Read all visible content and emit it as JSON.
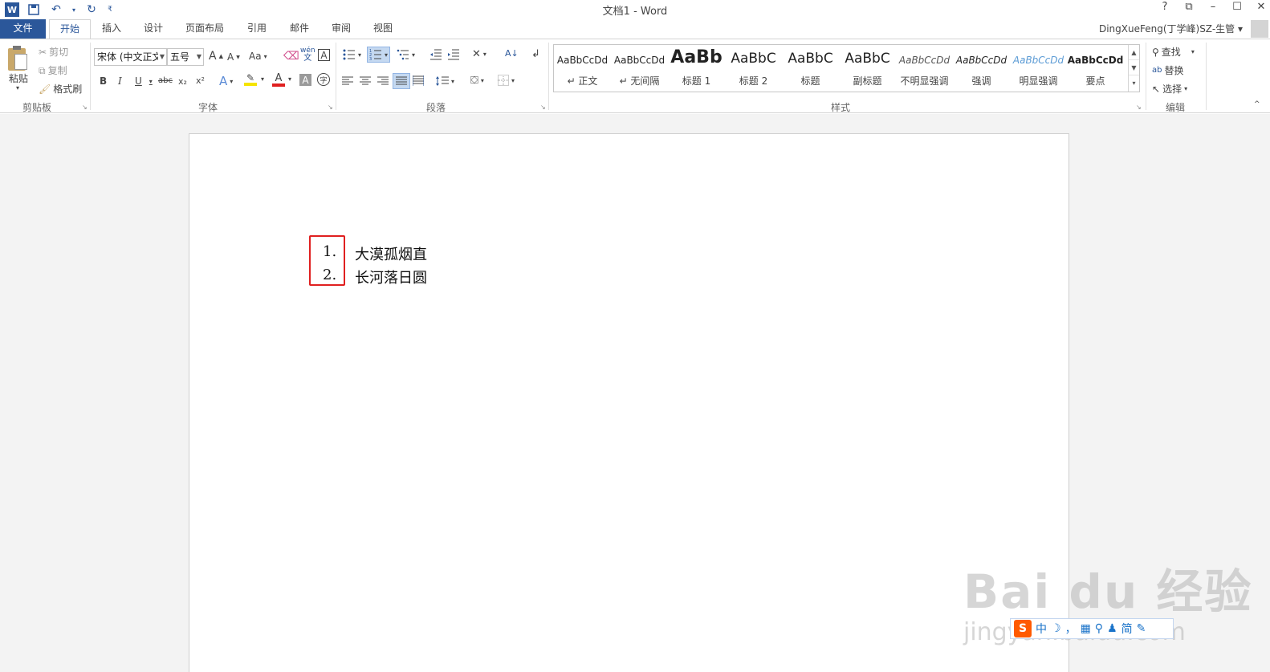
{
  "window": {
    "title": "文档1 - Word",
    "controls": [
      "?",
      "⧉",
      "–",
      "☐",
      "✕"
    ]
  },
  "quick_access": {
    "icons": [
      "word-app-icon",
      "save-icon",
      "undo-icon",
      "redo-icon",
      "customize-icon"
    ]
  },
  "tabs": [
    "文件",
    "开始",
    "插入",
    "设计",
    "页面布局",
    "引用",
    "邮件",
    "审阅",
    "视图"
  ],
  "active_tab": "开始",
  "user": {
    "name": "DingXueFeng(丁学峰)SZ-生管"
  },
  "clipboard": {
    "paste": "粘贴",
    "cut": "剪切",
    "copy": "复制",
    "format_painter": "格式刷",
    "label": "剪贴板"
  },
  "font": {
    "family": "宋体 (中文正文",
    "size": "五号",
    "label": "字体",
    "grow": "A",
    "shrink": "A",
    "case": "Aa",
    "bold": "B",
    "italic": "I",
    "underline": "U",
    "strike": "abc",
    "sub": "x₂",
    "sup": "x²",
    "phonetic": "wén",
    "border_char": "A",
    "effects": "A",
    "color_a": "A",
    "shade_a": "A",
    "enclose": "字"
  },
  "paragraph": {
    "label": "段落"
  },
  "styles": {
    "label": "样式",
    "items": [
      {
        "sample": "AaBbCcDd",
        "name": "↵ 正文"
      },
      {
        "sample": "AaBbCcDd",
        "name": "↵ 无间隔"
      },
      {
        "sample": "AaBb",
        "name": "标题 1"
      },
      {
        "sample": "AaBbC",
        "name": "标题 2"
      },
      {
        "sample": "AaBbC",
        "name": "标题"
      },
      {
        "sample": "AaBbC",
        "name": "副标题"
      },
      {
        "sample": "AaBbCcDd",
        "name": "不明显强调"
      },
      {
        "sample": "AaBbCcDd",
        "name": "强调"
      },
      {
        "sample": "AaBbCcDd",
        "name": "明显强调"
      },
      {
        "sample": "AaBbCcDd",
        "name": "要点"
      }
    ]
  },
  "editing": {
    "find": "查找",
    "replace": "替换",
    "select": "选择",
    "label": "编辑"
  },
  "document": {
    "list": [
      {
        "num": "1.",
        "text": "大漠孤烟直"
      },
      {
        "num": "2.",
        "text": "长河落日圆"
      }
    ]
  },
  "watermark": {
    "brand": "Bai du 经验",
    "url": "jingyan.baidu.com"
  },
  "ime": {
    "logo": "S",
    "items": [
      "中",
      "☽",
      "，",
      "▦",
      "⚲",
      "♟",
      "简",
      "✎"
    ]
  },
  "colors": {
    "accent": "#2b579a",
    "highlight_box": "#e02020",
    "font_color_bar": "#e02020",
    "highlight_bar": "#f5e400"
  }
}
